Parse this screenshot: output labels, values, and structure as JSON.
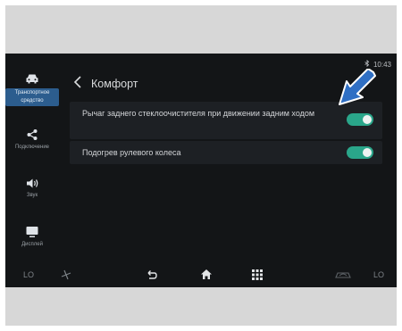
{
  "status_bar": {
    "time": "10:43",
    "icon": "bluetooth-icon"
  },
  "sidebar": {
    "items": [
      {
        "label": "Транспортное средство",
        "icon": "car-icon",
        "active": true
      },
      {
        "label": "Подключение",
        "icon": "share-icon",
        "active": false
      },
      {
        "label": "Звук",
        "icon": "speaker-icon",
        "active": false
      },
      {
        "label": "Дисплей",
        "icon": "display-icon",
        "active": false
      }
    ]
  },
  "header": {
    "title": "Комфорт",
    "back_icon": "chevron-left-icon"
  },
  "settings": [
    {
      "label": "Рычаг заднего стеклоочистителя при движении задним ходом",
      "enabled": true
    },
    {
      "label": "Подогрев рулевого колеса",
      "enabled": true
    }
  ],
  "bottom_bar": {
    "left_temp": "LO",
    "right_temp": "LO",
    "icons": [
      "fan-icon",
      "back-icon",
      "home-icon",
      "apps-grid-icon",
      "recirculation-icon"
    ]
  },
  "colors": {
    "toggle_on": "#2aa68a",
    "active_tab": "#2c5d8e",
    "annotation_arrow": "#2f6fc4"
  }
}
